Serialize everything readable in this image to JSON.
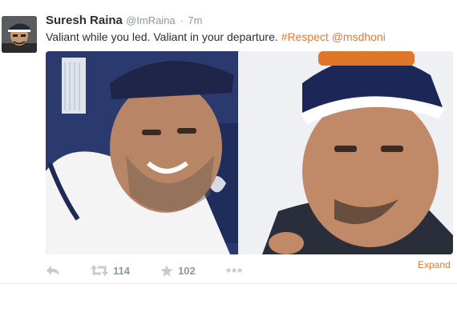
{
  "tweet": {
    "author_name": "Suresh Raina",
    "handle": "@ImRaina",
    "separator": "·",
    "time": "7m",
    "text_plain": "Valiant while you led. Valiant in your departure.",
    "hashtag": "#Respect",
    "mention": "@msdhoni",
    "expand_label": "Expand"
  },
  "actions": {
    "retweet_count": "114",
    "favorite_count": "102"
  },
  "colors": {
    "link": "#e07b39",
    "meta": "#8899a6",
    "text": "#292f33"
  },
  "icons": [
    "reply-icon",
    "retweet-icon",
    "star-icon",
    "more-icon"
  ]
}
